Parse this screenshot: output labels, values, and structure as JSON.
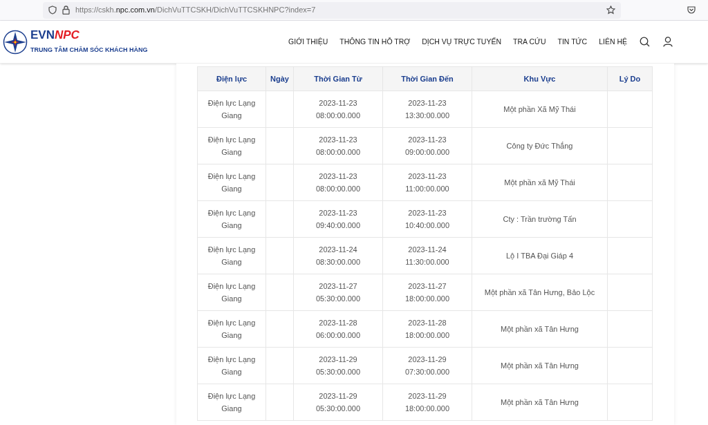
{
  "browser": {
    "url_prefix": "https://cskh.",
    "url_domain": "npc.com.vn",
    "url_path": "/DichVuTTCSKH/DichVuTTCSKHNPC?index=7"
  },
  "logo": {
    "brand_main": "EVN",
    "brand_accent": "NPC",
    "tagline": "TRUNG TÂM CHĂM SÓC KHÁCH HÀNG"
  },
  "nav": [
    "GIỚI THIỆU",
    "THÔNG TIN HỖ TRỢ",
    "DỊCH VỤ TRỰC TUYẾN",
    "TRA CỨU",
    "TIN TỨC",
    "LIÊN HỆ"
  ],
  "table": {
    "columns": [
      "Điện lực",
      "Ngày",
      "Thời Gian Từ",
      "Thời Gian Đến",
      "Khu Vực",
      "Lý Do"
    ],
    "rows": [
      [
        "Điện lực Lạng Giang",
        "",
        "2023-11-23 08:00:00.000",
        "2023-11-23 13:30:00.000",
        "Một phần Xã Mỹ Thái",
        ""
      ],
      [
        "Điện lực Lạng Giang",
        "",
        "2023-11-23 08:00:00.000",
        "2023-11-23 09:00:00.000",
        "Công ty Đức Thắng",
        ""
      ],
      [
        "Điện lực Lạng Giang",
        "",
        "2023-11-23 08:00:00.000",
        "2023-11-23 11:00:00.000",
        "Một phần xã Mỹ Thái",
        ""
      ],
      [
        "Điện lực Lạng Giang",
        "",
        "2023-11-23 09:40:00.000",
        "2023-11-23 10:40:00.000",
        "Cty : Trần trường Tấn",
        ""
      ],
      [
        "Điện lực Lạng Giang",
        "",
        "2023-11-24 08:30:00.000",
        "2023-11-24 11:30:00.000",
        "Lộ I TBA Đại Giáp 4",
        ""
      ],
      [
        "Điện lực Lạng Giang",
        "",
        "2023-11-27 05:30:00.000",
        "2023-11-27 18:00:00.000",
        "Một phần xã Tân Hưng, Bảo Lộc",
        ""
      ],
      [
        "Điện lực Lạng Giang",
        "",
        "2023-11-28 06:00:00.000",
        "2023-11-28 18:00:00.000",
        "Một phần xã Tân Hưng",
        ""
      ],
      [
        "Điện lực Lạng Giang",
        "",
        "2023-11-29 05:30:00.000",
        "2023-11-29 07:30:00.000",
        "Một phần xã Tân Hưng",
        ""
      ],
      [
        "Điện lực Lạng Giang",
        "",
        "2023-11-29 05:30:00.000",
        "2023-11-29 18:00:00.000",
        "Một phần xã Tân Hưng",
        ""
      ]
    ]
  }
}
